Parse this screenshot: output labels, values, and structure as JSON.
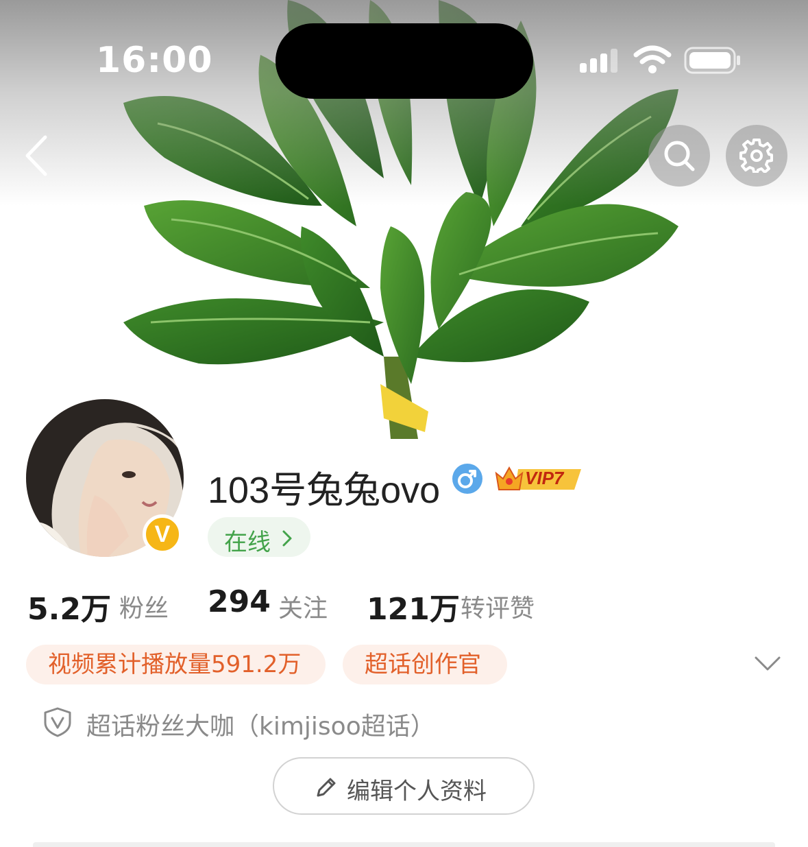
{
  "status_bar": {
    "time": "16:00"
  },
  "profile": {
    "username": "103号兔兔ovo",
    "gender": "male",
    "vip_label": "VIP7",
    "verified_badge": "V",
    "online_label": "在线"
  },
  "stats": [
    {
      "value": "5.2万",
      "label": "粉丝"
    },
    {
      "value": "294",
      "label": "关注"
    },
    {
      "value": "121万",
      "label": "转评赞"
    }
  ],
  "tags": [
    "视频累计播放量591.2万",
    "超话创作官"
  ],
  "super_topic": "超话粉丝大咖（kimjisoo超话）",
  "edit_profile_label": "编辑个人资料",
  "colors": {
    "accent_orange": "#e2602a",
    "online_green": "#43a34a",
    "vip_gold": "#f6b616",
    "gender_blue": "#5ba8ea"
  },
  "icons": [
    "back-icon",
    "search-icon",
    "gear-icon",
    "signal-icon",
    "wifi-icon",
    "battery-icon",
    "male-icon",
    "crown-icon",
    "chevron-right-icon",
    "chevron-down-icon",
    "shield-icon",
    "pencil-icon"
  ]
}
